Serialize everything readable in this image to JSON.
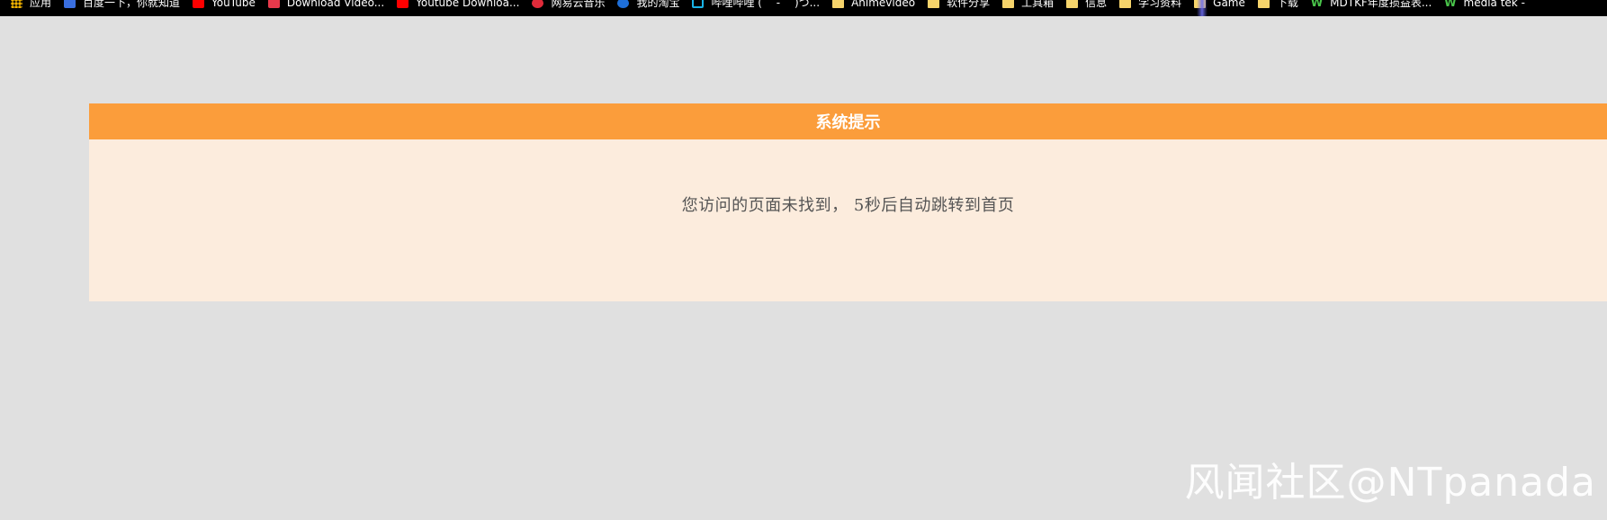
{
  "bookmarks": [
    {
      "label": "应用",
      "icon": "apps-icon"
    },
    {
      "label": "百度一下，你就知道",
      "icon": "baidu-icon"
    },
    {
      "label": "YouTube",
      "icon": "youtube-icon"
    },
    {
      "label": "Download Video...",
      "icon": "download-icon"
    },
    {
      "label": "Youtube Downloa...",
      "icon": "youtube-icon"
    },
    {
      "label": "网易云音乐",
      "icon": "netease-icon"
    },
    {
      "label": "我的淘宝",
      "icon": "taobao-icon"
    },
    {
      "label": "哔哩哔哩 ( ゜- ゜)つ...",
      "icon": "bilibili-icon"
    },
    {
      "label": "Animevideo",
      "icon": "folder-icon"
    },
    {
      "label": "软件分享",
      "icon": "folder-icon"
    },
    {
      "label": "工具箱",
      "icon": "folder-icon"
    },
    {
      "label": "信息",
      "icon": "folder-icon"
    },
    {
      "label": "学习资料",
      "icon": "folder-icon"
    },
    {
      "label": "Game",
      "icon": "folder-icon"
    },
    {
      "label": "下载",
      "icon": "folder-icon"
    },
    {
      "label": "MDTKF年度损益表...",
      "icon": "w-icon"
    },
    {
      "label": "media tek -",
      "icon": "w-icon"
    }
  ],
  "dialog": {
    "title": "系统提示",
    "message": "您访问的页面未找到， 5秒后自动跳转到首页"
  },
  "watermark": "风闻社区@NTpanada",
  "colors": {
    "header": "#fb9d3b",
    "body": "#fcecdd",
    "page": "#e0e0e0"
  }
}
